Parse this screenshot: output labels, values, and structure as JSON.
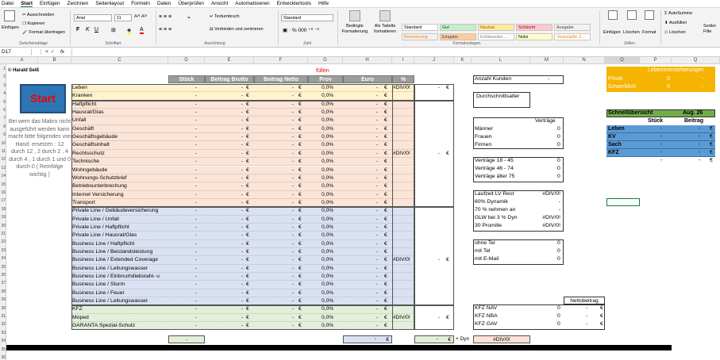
{
  "menu": {
    "datei": "Datei",
    "start": "Start",
    "einfuegen": "Einfügen",
    "zeichnen": "Zeichnen",
    "seitenlayout": "Seitenlayout",
    "formeln": "Formeln",
    "daten": "Daten",
    "ueberpruefen": "Überprüfen",
    "ansicht": "Ansicht",
    "automatisieren": "Automatisieren",
    "entwickler": "Entwicklertools",
    "hilfe": "Hilfe"
  },
  "ribbon": {
    "einfuegen": "Einfügen",
    "ausschneiden": "Ausschneiden",
    "kopieren": "Kopieren",
    "format_uebertragen": "Format übertragen",
    "zwischenablage": "Zwischenablage",
    "font": "Arial",
    "size": "11",
    "schriftart": "Schriftart",
    "textumbruch": "Textumbruch",
    "verbinden": "Verbinden und zentrieren",
    "ausrichtung": "Ausrichtung",
    "numfmt": "Standard",
    "zahl": "Zahl",
    "bedingte": "Bedingte Formatierung",
    "als_tabelle": "Als Tabelle formatieren",
    "formatvorlagen": "Formatvorlagen",
    "einfuegen2": "Einfügen",
    "loeschen": "Löschen",
    "format": "Format",
    "zellen": "Zellen",
    "autosumme": "AutoSumme",
    "ausfuellen": "Ausfüllen",
    "loeschen2": "Löschen",
    "sortieren": "Sortier Filte",
    "styles": [
      {
        "t": "Standard",
        "bg": "#ffffff",
        "fg": "#000"
      },
      {
        "t": "Gut",
        "bg": "#c6efce",
        "fg": "#006100"
      },
      {
        "t": "Neutral",
        "bg": "#ffeb9c",
        "fg": "#9c5700"
      },
      {
        "t": "Schlecht",
        "bg": "#ffc7ce",
        "fg": "#9c0006"
      },
      {
        "t": "Ausgabe",
        "bg": "#f2f2f2",
        "fg": "#3f3f3f"
      },
      {
        "t": "Berechnung",
        "bg": "#f2f2f2",
        "fg": "#fa7d00"
      },
      {
        "t": "Eingabe",
        "bg": "#ffcc99",
        "fg": "#3f3f76"
      },
      {
        "t": "Erklärender ...",
        "bg": "#ffffff",
        "fg": "#7f7f7f"
      },
      {
        "t": "Notiz",
        "bg": "#ffffcc",
        "fg": "#000"
      },
      {
        "t": "Verknüpfte Z...",
        "bg": "#ffffff",
        "fg": "#fa7d00"
      }
    ]
  },
  "formula": {
    "namebox": "D17",
    "fx": "fx"
  },
  "columns": [
    "A",
    "B",
    "C",
    "D",
    "E",
    "F",
    "G",
    "H",
    "I",
    "J",
    "K",
    "L",
    "M",
    "N",
    "O",
    "P",
    "Q"
  ],
  "rows": [
    "1",
    "2",
    "3",
    "4",
    "5",
    "6",
    "7",
    "8",
    "9",
    "10",
    "11",
    "12",
    "13",
    "14",
    "15",
    "16",
    "17",
    "18",
    "19",
    "20",
    "21",
    "22",
    "23",
    "24",
    "25",
    "26",
    "27",
    "28",
    "29",
    "30",
    "31",
    "32",
    "33",
    "34",
    "35",
    "36"
  ],
  "sheet": {
    "author": "© Harald Seiß",
    "fuellen": "füllen",
    "headers": {
      "stueck": "Stück",
      "brutto": "Beitrag Brutto",
      "netto": "Beitrag Netto",
      "prov": "Prov",
      "euro": "Euro",
      "pct": "%"
    },
    "start_button": "Start",
    "macro_note": "Bei wem das Makro nicht ausgeführt werden kann macht bitte folgendes von Hand: ersetzen : 12 durch 12 , 2 durch 2 , 4 durch 4 , 1 durch 1 und 0 durch 0  ( Reinfolge wichtig )",
    "items": [
      {
        "n": "Leben",
        "g": "y"
      },
      {
        "n": "Kranken",
        "g": "y"
      },
      {
        "n": "Haftpflicht",
        "g": "p"
      },
      {
        "n": "Hausrat/Glas",
        "g": "p"
      },
      {
        "n": "Unfall",
        "g": "p"
      },
      {
        "n": "Geschäft",
        "g": "p"
      },
      {
        "n": "Geschäftsgebäude",
        "g": "p"
      },
      {
        "n": "Geschäftsinhalt",
        "g": "p"
      },
      {
        "n": "Rechtsschutz",
        "g": "p"
      },
      {
        "n": "Technische",
        "g": "p"
      },
      {
        "n": "Wohngebäude",
        "g": "p"
      },
      {
        "n": "Wohnungs-Schutzbrief",
        "g": "p"
      },
      {
        "n": "Betriebsunterbrechung",
        "g": "p"
      },
      {
        "n": "Internet Versicherung",
        "g": "p"
      },
      {
        "n": "Transport",
        "g": "p"
      },
      {
        "n": "Private Line / Gebäudeversicherung",
        "g": "b"
      },
      {
        "n": "Private Line / Unfall",
        "g": "b"
      },
      {
        "n": "Private Line / Haftpflicht",
        "g": "b"
      },
      {
        "n": "Private Line / Hausrat/Glas",
        "g": "b"
      },
      {
        "n": "Business Line / Haftpflicht",
        "g": "b"
      },
      {
        "n": "Business Line / Beistandsleistung",
        "g": "b"
      },
      {
        "n": "Business Line / Extended Coverage",
        "g": "b"
      },
      {
        "n": "Business Line / Leitungswasser",
        "g": "b"
      },
      {
        "n": "Business Line / Einbruchdiebstahl- u",
        "g": "b"
      },
      {
        "n": "Business Line / Sturm",
        "g": "b"
      },
      {
        "n": "Business Line / Feuer",
        "g": "b"
      },
      {
        "n": "Business Line / Leitungswasser",
        "g": "b"
      },
      {
        "n": "KFZ",
        "g": "g"
      },
      {
        "n": "Moped",
        "g": "g"
      },
      {
        "n": "GARANTA Spezial-Schutz",
        "g": "g"
      }
    ],
    "dash": "-",
    "euro_sym": "€",
    "zero_pct": "0,0%",
    "div0": "#DIV/0!",
    "plus_dyn": "+ Dyn",
    "anzahl_kunden": "Anzahl Kunden",
    "durchschnittsalter": "Durchschnittsalter",
    "vertraege": "Verträge",
    "persons": [
      {
        "l": "Männer",
        "v": "0"
      },
      {
        "l": "Frauen",
        "v": "0"
      },
      {
        "l": "Firmen",
        "v": "0"
      }
    ],
    "ages": [
      {
        "l": "Verträge  18 - 45",
        "v": "0"
      },
      {
        "l": "Verträge  46 - 74",
        "v": "0"
      },
      {
        "l": "Verträge  älter 75",
        "v": "0"
      }
    ],
    "lv": [
      {
        "l": "Laufzeit LV Rest",
        "v": "#DIV/0!"
      },
      {
        "l": "60% Dynamik",
        "v": "-"
      },
      {
        "l": "70 % nehmen an",
        "v": "-"
      },
      {
        "l": "GLW bei 3 % Dyn",
        "v": "#DIV/0!"
      },
      {
        "l": "30 Promille",
        "v": "#DIV/0!"
      }
    ],
    "tel": [
      {
        "l": "ohne Tel",
        "v": "0"
      },
      {
        "l": "mit Tel",
        "v": "0"
      },
      {
        "l": "mit E-Mail",
        "v": "0"
      }
    ],
    "nettobeitrag": "Nettobeitrag",
    "kfz": [
      {
        "l": "KFZ NAV",
        "v": "0"
      },
      {
        "l": "KFZ NBA",
        "v": "0"
      },
      {
        "l": "KFZ GAV",
        "v": "0"
      }
    ],
    "lv_box": {
      "title": "Lebensversicherungen",
      "privat": "Privat",
      "gewerblich": "Gewerblich",
      "zero": "0"
    },
    "schnell": {
      "title": "Schnellübersicht",
      "date": "Aug. 26",
      "stueck": "Stück",
      "beitrag": "Beitrag",
      "rows": [
        "Leben",
        "KV",
        "Sach",
        "KFZ"
      ]
    }
  }
}
